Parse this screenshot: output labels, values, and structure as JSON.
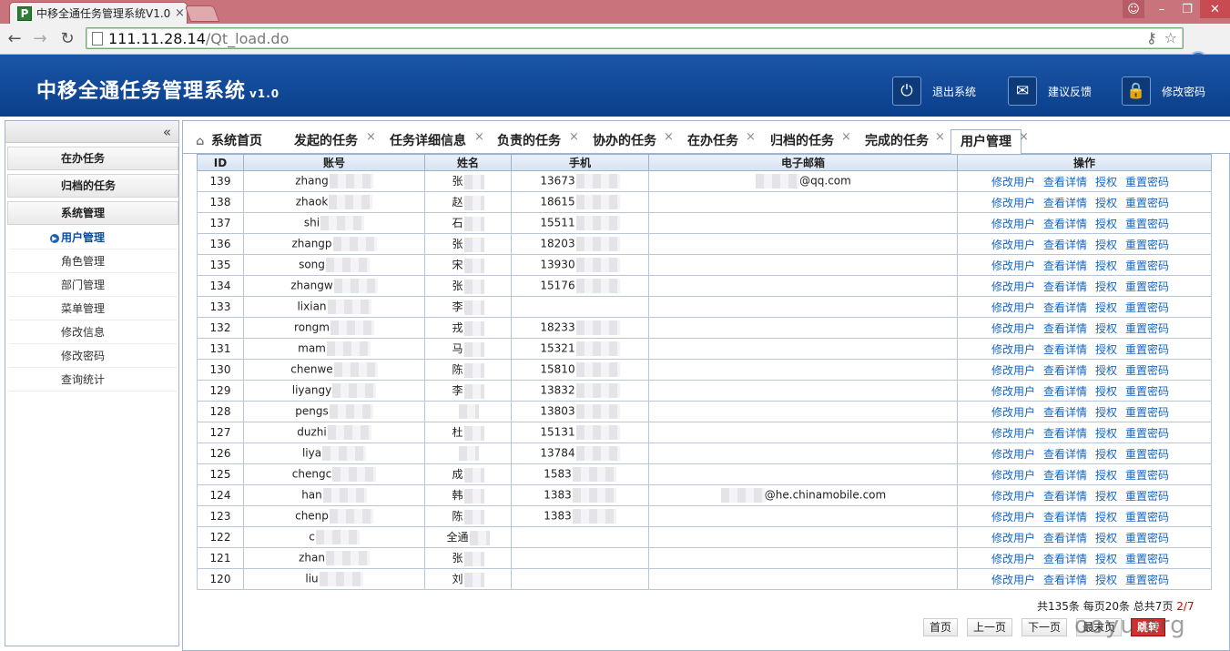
{
  "browser": {
    "tab_title": "中移全通任务管理系统V1.0",
    "favicon": "P",
    "url_host": "111.11.28.14",
    "url_path": "/Qt_load.do"
  },
  "header": {
    "title": "中移全通任务管理系统",
    "version": "v1.0",
    "logout": "退出系统",
    "feedback": "建议反馈",
    "change_password": "修改密码"
  },
  "sidebar": {
    "collapse": "«",
    "sections": [
      "在办任务",
      "归档的任务",
      "系统管理"
    ],
    "items": [
      "用户管理",
      "角色管理",
      "部门管理",
      "菜单管理",
      "修改信息",
      "修改密码",
      "查询统计"
    ]
  },
  "tabs": [
    {
      "label": "系统首页"
    },
    {
      "label": "发起的任务"
    },
    {
      "label": "任务详细信息"
    },
    {
      "label": "负责的任务"
    },
    {
      "label": "协办的任务"
    },
    {
      "label": "在办任务"
    },
    {
      "label": "归档的任务"
    },
    {
      "label": "完成的任务"
    },
    {
      "label": "用户管理"
    }
  ],
  "table": {
    "columns": [
      "ID",
      "账号",
      "姓名",
      "手机",
      "电子邮箱",
      "操作"
    ],
    "actions": [
      "修改用户",
      "查看详情",
      "授权",
      "重置密码"
    ],
    "rows": [
      {
        "id": "139",
        "account": "zhang",
        "name": "张",
        "phone": "13673",
        "email": "@qq.com"
      },
      {
        "id": "138",
        "account": "zhaok",
        "name": "赵",
        "phone": "18615",
        "email": ""
      },
      {
        "id": "137",
        "account": "shi",
        "name": "石",
        "phone": "15511",
        "email": ""
      },
      {
        "id": "136",
        "account": "zhangp",
        "name": "张",
        "phone": "18203",
        "email": ""
      },
      {
        "id": "135",
        "account": "song",
        "name": "宋",
        "phone": "13930",
        "email": ""
      },
      {
        "id": "134",
        "account": "zhangw",
        "name": "张",
        "phone": "15176",
        "email": ""
      },
      {
        "id": "133",
        "account": "lixian",
        "name": "李",
        "phone": "",
        "email": ""
      },
      {
        "id": "132",
        "account": "rongm",
        "name": "戎",
        "phone": "18233",
        "email": ""
      },
      {
        "id": "131",
        "account": "mam",
        "name": "马",
        "phone": "15321",
        "email": ""
      },
      {
        "id": "130",
        "account": "chenwe",
        "name": "陈",
        "phone": "15810",
        "email": ""
      },
      {
        "id": "129",
        "account": "liyangy",
        "name": "李",
        "phone": "13832",
        "email": ""
      },
      {
        "id": "128",
        "account": "pengs",
        "name": "",
        "phone": "13803",
        "email": ""
      },
      {
        "id": "127",
        "account": "duzhi",
        "name": "杜",
        "phone": "15131",
        "email": ""
      },
      {
        "id": "126",
        "account": "liya",
        "name": "",
        "phone": "13784",
        "email": ""
      },
      {
        "id": "125",
        "account": "chengc",
        "name": "成",
        "phone": "1583",
        "email": ""
      },
      {
        "id": "124",
        "account": "han",
        "name": "韩",
        "phone": "1383",
        "email": "@he.chinamobile.com"
      },
      {
        "id": "123",
        "account": "chenp",
        "name": "陈",
        "phone": "1383",
        "email": ""
      },
      {
        "id": "122",
        "account": "c",
        "name": "全通",
        "phone": "",
        "email": ""
      },
      {
        "id": "121",
        "account": "zhan",
        "name": "张",
        "phone": "",
        "email": ""
      },
      {
        "id": "120",
        "account": "liu",
        "name": "刘",
        "phone": "",
        "email": ""
      }
    ]
  },
  "pager": {
    "info": "共135条 每页20条 总共7页",
    "current": "2/7",
    "first": "首页",
    "prev": "上一页",
    "next": "下一页",
    "last": "最末页",
    "go": "跳转"
  },
  "watermark": "ooyu.org",
  "colors": {
    "header": "#0a3f8c",
    "link": "#1565c0",
    "titlebar": "#c9747c"
  }
}
